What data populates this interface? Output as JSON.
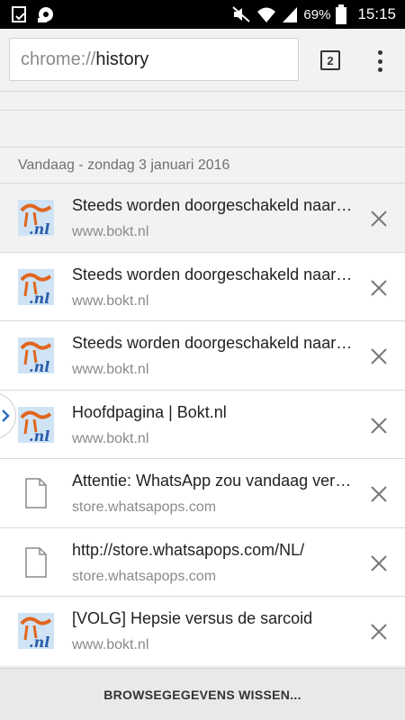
{
  "status_bar": {
    "battery": "69%",
    "time": "15:15",
    "left_icons": [
      "device-icon",
      "cloud-sync-icon"
    ],
    "right_icons": [
      "mute-icon",
      "wifi-icon",
      "signal-icon",
      "battery-icon"
    ]
  },
  "toolbar": {
    "url_scheme": "chrome://",
    "url_path": "history",
    "tab_count": "2"
  },
  "history": {
    "section_label": "Vandaag - zondag 3 januari 2016",
    "items": [
      {
        "title": "Steeds worden doorgeschakeld naar advertentie",
        "url": "www.bokt.nl",
        "favicon": "bokt-favicon"
      },
      {
        "title": "Steeds worden doorgeschakeld naar advertentie",
        "url": "www.bokt.nl",
        "favicon": "bokt-favicon"
      },
      {
        "title": "Steeds worden doorgeschakeld naar advertentie",
        "url": "www.bokt.nl",
        "favicon": "bokt-favicon"
      },
      {
        "title": "Hoofdpagina | Bokt.nl",
        "url": "www.bokt.nl",
        "favicon": "bokt-favicon"
      },
      {
        "title": "Attentie: WhatsApp zou vandaag verlopen",
        "url": "store.whatsapops.com",
        "favicon": "page-icon"
      },
      {
        "title": "http://store.whatsapops.com/NL/",
        "url": "store.whatsapops.com",
        "favicon": "page-icon"
      },
      {
        "title": "[VOLG] Hepsie versus de sarcoid",
        "url": "www.bokt.nl",
        "favicon": "bokt-favicon"
      }
    ]
  },
  "footer": {
    "clear_label": "BROWSEGEGEVENS WISSEN..."
  },
  "colors": {
    "bokt_orange": "#e0661e",
    "bokt_blue": "#2a5ca8",
    "bokt_bg": "#cfe3f5"
  }
}
